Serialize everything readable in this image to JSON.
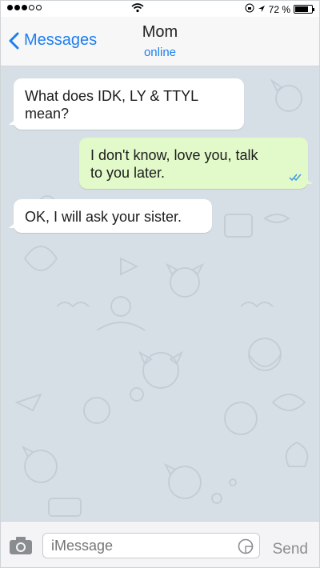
{
  "status_bar": {
    "battery_text": "72 %",
    "battery_level": 0.72,
    "signal_filled": 3,
    "signal_total": 5
  },
  "nav": {
    "back_label": "Messages",
    "title": "Mom",
    "subtitle": "online"
  },
  "messages": [
    {
      "direction": "in",
      "text_line1": "What does IDK, LY & TTYL",
      "text_line2": "mean?"
    },
    {
      "direction": "out",
      "text_line1": "I don't know, love you, talk",
      "text_line2": "to you later.",
      "read": true
    },
    {
      "direction": "in",
      "text_line1": "OK, I will ask your sister."
    }
  ],
  "input": {
    "placeholder": "iMessage",
    "send_label": "Send"
  },
  "colors": {
    "accent": "#1d7ff0",
    "chat_bg": "#d7dfe6",
    "outgoing_bubble": "#e2f9c9",
    "incoming_bubble": "#ffffff"
  }
}
